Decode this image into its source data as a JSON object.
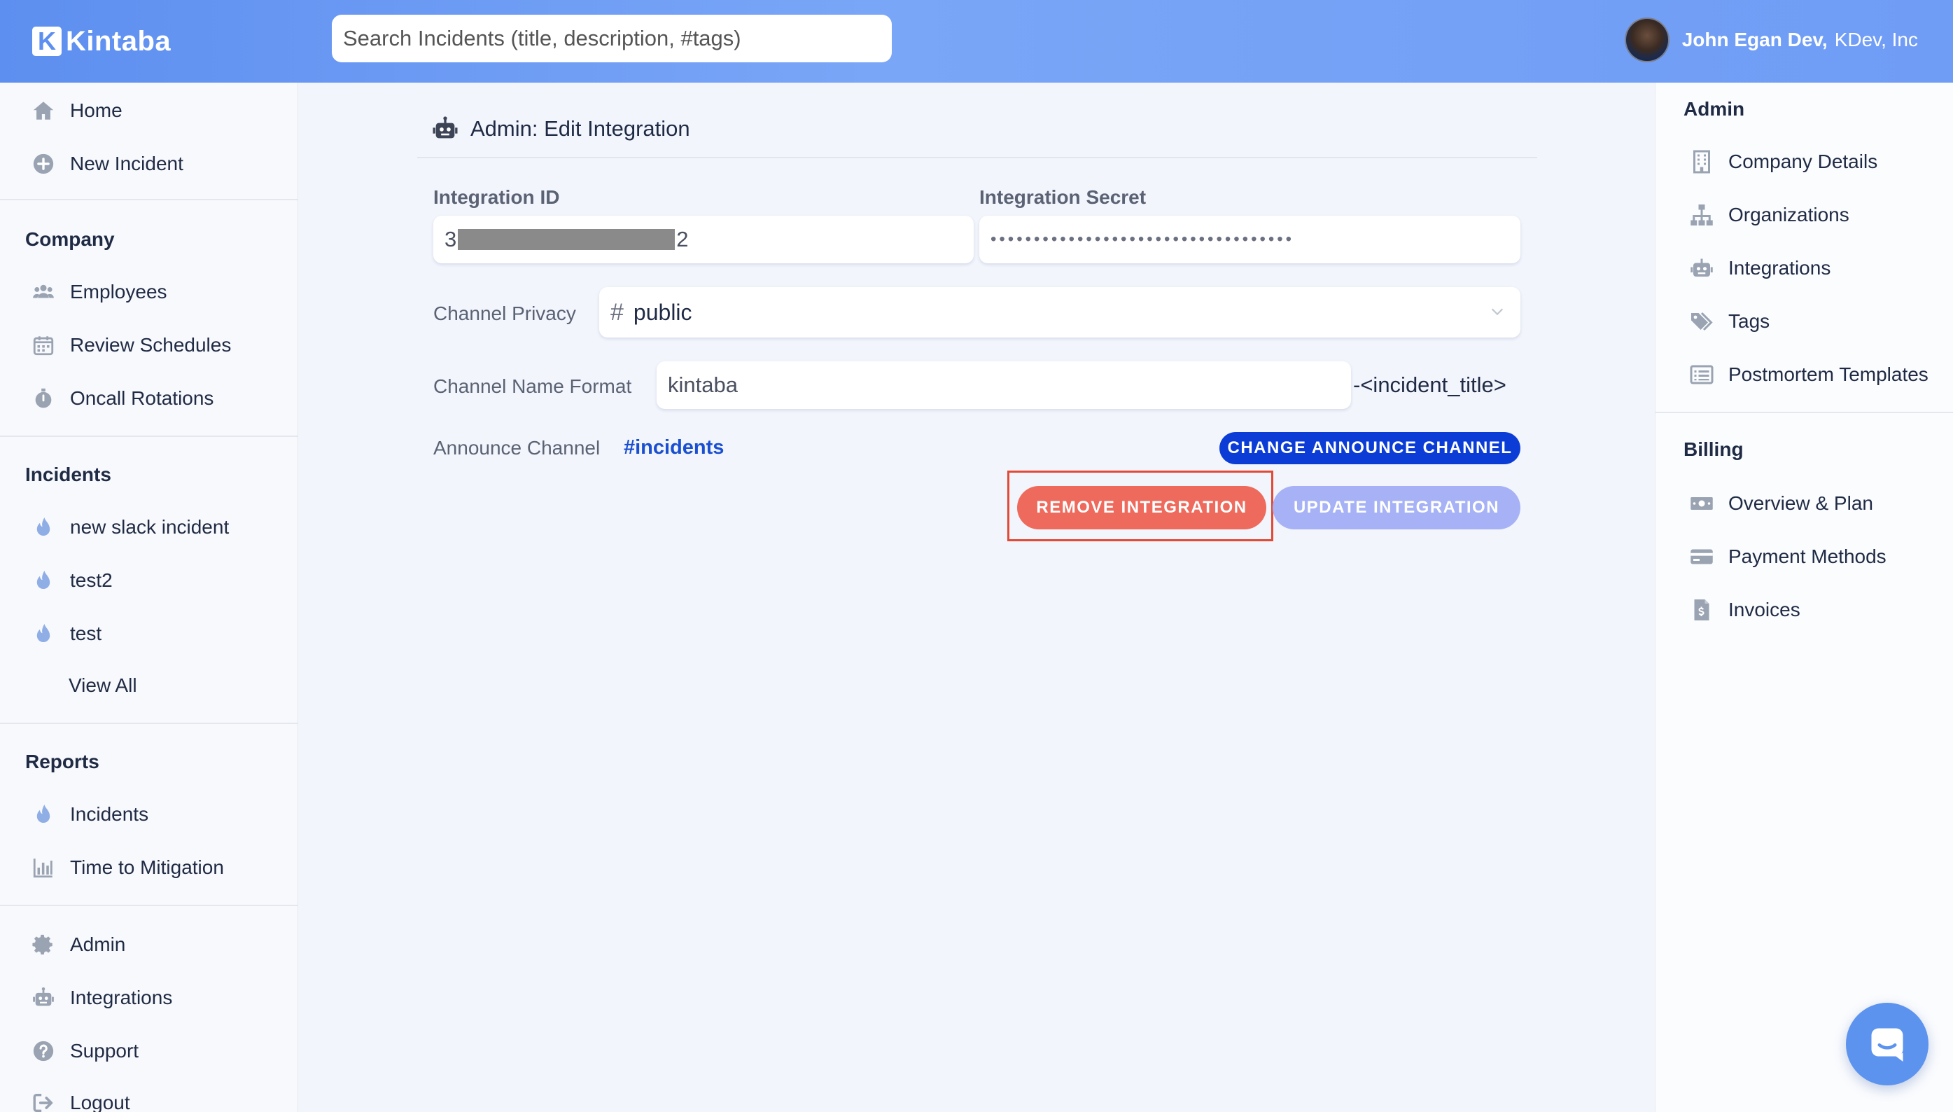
{
  "brand": {
    "logo_letter": "K",
    "name": "Kintaba"
  },
  "search": {
    "placeholder": "Search Incidents (title, description, #tags)"
  },
  "user": {
    "name": "John Egan Dev,",
    "company": "KDev, Inc"
  },
  "sidebar": {
    "top_items": [
      {
        "label": "Home",
        "icon": "home-icon"
      },
      {
        "label": "New Incident",
        "icon": "plus-circle-icon"
      }
    ],
    "company": {
      "title": "Company",
      "items": [
        {
          "label": "Employees",
          "icon": "users-icon"
        },
        {
          "label": "Review Schedules",
          "icon": "calendar-icon"
        },
        {
          "label": "Oncall Rotations",
          "icon": "stopwatch-icon"
        }
      ]
    },
    "incidents": {
      "title": "Incidents",
      "items": [
        {
          "label": "new slack incident",
          "icon": "flame-icon"
        },
        {
          "label": "test2",
          "icon": "flame-icon"
        },
        {
          "label": "test",
          "icon": "flame-icon"
        }
      ],
      "view_all": "View All"
    },
    "reports": {
      "title": "Reports",
      "items": [
        {
          "label": "Incidents",
          "icon": "flame-icon"
        },
        {
          "label": "Time to Mitigation",
          "icon": "bar-chart-icon"
        }
      ]
    },
    "bottom_items": [
      {
        "label": "Admin",
        "icon": "gear-icon"
      },
      {
        "label": "Integrations",
        "icon": "robot-icon"
      },
      {
        "label": "Support",
        "icon": "question-circle-icon"
      },
      {
        "label": "Logout",
        "icon": "logout-icon"
      }
    ]
  },
  "main": {
    "title": "Admin: Edit Integration",
    "integration_id": {
      "label": "Integration ID",
      "prefix": "3",
      "suffix": "2"
    },
    "integration_secret": {
      "label": "Integration Secret",
      "masked": "•••••••••••••••••••••••••••••••••••"
    },
    "channel_privacy": {
      "label": "Channel Privacy",
      "hash": "#",
      "value": "public"
    },
    "channel_name_format": {
      "label": "Channel Name Format",
      "value": "kintaba",
      "suffix": "-<incident_title>"
    },
    "announce_channel": {
      "label": "Announce Channel",
      "value": "#incidents"
    },
    "buttons": {
      "change_announce": "CHANGE ANNOUNCE CHANNEL",
      "remove": "REMOVE INTEGRATION",
      "update": "UPDATE INTEGRATION"
    }
  },
  "right_sidebar": {
    "admin": {
      "title": "Admin",
      "items": [
        {
          "label": "Company Details",
          "icon": "building-icon"
        },
        {
          "label": "Organizations",
          "icon": "org-chart-icon"
        },
        {
          "label": "Integrations",
          "icon": "robot-icon"
        },
        {
          "label": "Tags",
          "icon": "tags-icon"
        },
        {
          "label": "Postmortem Templates",
          "icon": "list-icon"
        }
      ]
    },
    "billing": {
      "title": "Billing",
      "items": [
        {
          "label": "Overview & Plan",
          "icon": "money-icon"
        },
        {
          "label": "Payment Methods",
          "icon": "credit-card-icon"
        },
        {
          "label": "Invoices",
          "icon": "invoice-icon"
        }
      ]
    }
  },
  "colors": {
    "accent": "#5d8ff0",
    "danger": "#ee6a5c",
    "primary_button": "#0b3dd6",
    "disabled_button": "#a6b2f5",
    "link": "#1a4fd1"
  }
}
